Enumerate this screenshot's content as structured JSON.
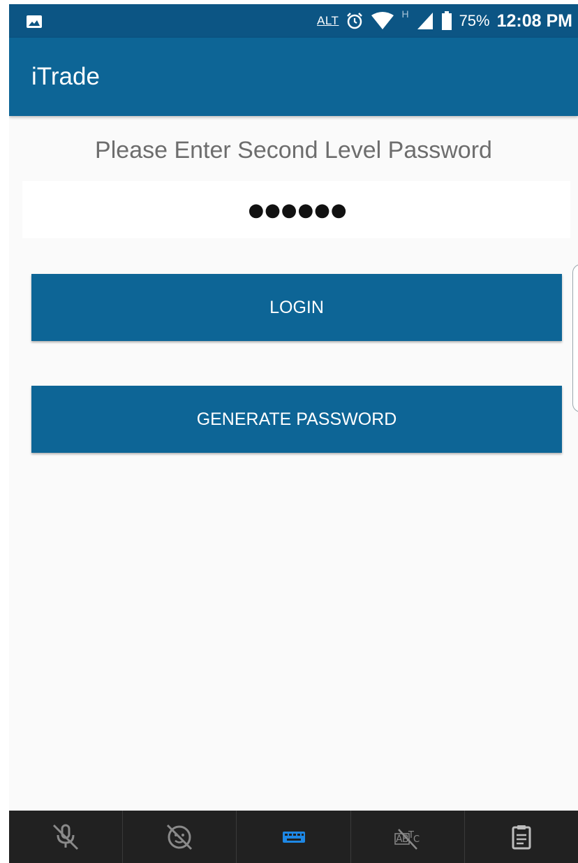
{
  "status_bar": {
    "carrier_tag": "ALT",
    "network_type": "H",
    "battery": "75%",
    "time": "12:08 PM",
    "icons": [
      "image-icon",
      "alarm-icon",
      "wifi-icon",
      "signal-icon",
      "battery-icon"
    ]
  },
  "app_bar": {
    "title": "iTrade"
  },
  "form": {
    "prompt": "Please Enter Second Level Password",
    "password_value": "●●●●●●"
  },
  "buttons": {
    "login": "LOGIN",
    "generate_password": "GENERATE PASSWORD"
  },
  "keyboard_toolbar": {
    "items": [
      "mic-off-icon",
      "emoji-off-icon",
      "keyboard-icon",
      "spellcheck-off-icon",
      "clipboard-icon"
    ]
  },
  "colors": {
    "primary": "#0d6596",
    "status_bar": "#0c5584",
    "background": "#fafafa",
    "toolbar": "#212121",
    "toolbar_active": "#1e88e5"
  }
}
